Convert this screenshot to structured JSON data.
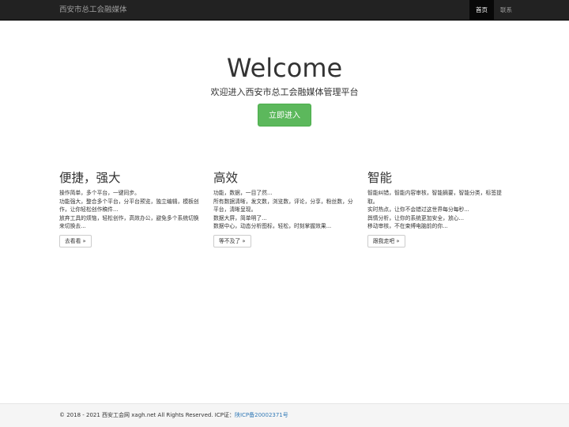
{
  "navbar": {
    "brand": "西安市总工会融媒体",
    "items": [
      {
        "label": "首页"
      },
      {
        "label": "联系"
      }
    ]
  },
  "hero": {
    "title": "Welcome",
    "subtitle": "欢迎进入西安市总工会融媒体管理平台",
    "button": "立即进入"
  },
  "features": [
    {
      "title": "便捷，强大",
      "lines": [
        "操作简单，多个平台，一键同步。",
        "功能强大，整合多个平台，分平台预览，独立编辑，模板创作，让你轻松创作稿件...",
        "放弃工具的烦恼，轻松创作，高效办公，避免多个系统切换来切换去..."
      ],
      "button": "去看看 »"
    },
    {
      "title": "高效",
      "lines": [
        "功能，数据，一目了然...",
        "所有数据清晰，发文数，浏览数，评论，分享，粉丝数，分平台，清晰呈现。",
        "数据大屏，简单明了...",
        "数据中心，动态分析图标，轻松，时刻掌握效果..."
      ],
      "button": "等不及了 »"
    },
    {
      "title": "智能",
      "lines": [
        "智能纠错，智能内容审核，智能摘要，智能分类，标签提取。",
        "实时热点，让你不会错过这世界每分每秒...",
        "舆情分析，让你的系统更加安全，放心...",
        "移动审核，不在束缚电脑前的你..."
      ],
      "button": "跟我走吧 »"
    }
  ],
  "footer": {
    "copyright": "© 2018 - 2021 西安工会网 xagh.net All Rights Reserved. ICP证：",
    "icp": "陕ICP备20002371号"
  },
  "colors": {
    "navbar_bg": "#222222",
    "primary_button": "#5cb85c",
    "link": "#337ab7",
    "footer_bg": "#f5f5f5"
  }
}
